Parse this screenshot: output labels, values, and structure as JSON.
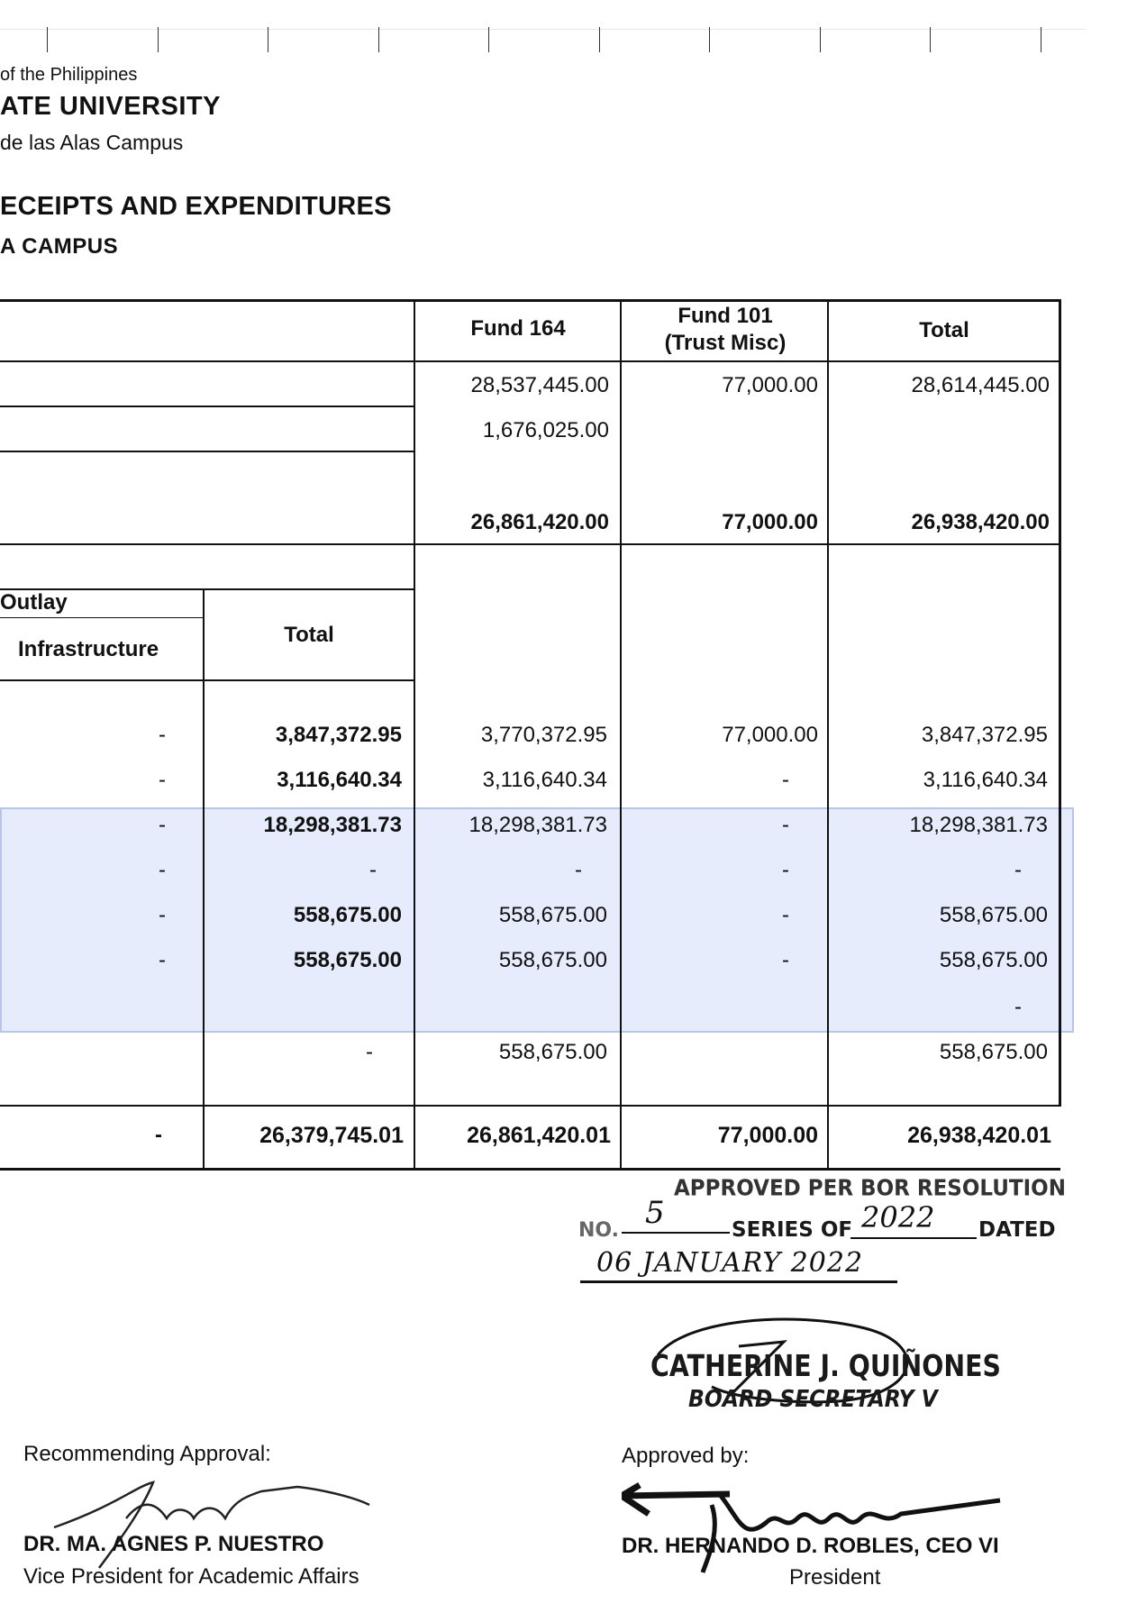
{
  "header": {
    "country": "of the Philippines",
    "university": "ATE UNIVERSITY",
    "campus": "de las Alas Campus",
    "title": "ECEIPTS AND EXPENDITURES",
    "subtitle": "A CAMPUS"
  },
  "table": {
    "col_fund164": "Fund 164",
    "col_fund101_l1": "Fund 101",
    "col_fund101_l2": "(Trust Misc)",
    "col_total": "Total",
    "sub_outlay": "Outlay",
    "sub_infrastructure": "Infrastructure",
    "sub_total": "Total",
    "receipts": [
      {
        "fund164": "28,537,445.00",
        "fund101": "77,000.00",
        "total": "28,614,445.00"
      },
      {
        "fund164": "1,676,025.00",
        "fund101": "",
        "total": ""
      },
      {
        "fund164": "26,861,420.00",
        "fund101": "77,000.00",
        "total": "26,938,420.00"
      }
    ],
    "expenditures": [
      {
        "infra": "-",
        "subtotal": "3,847,372.95",
        "fund164": "3,770,372.95",
        "fund101": "77,000.00",
        "total": "3,847,372.95"
      },
      {
        "infra": "-",
        "subtotal": "3,116,640.34",
        "fund164": "3,116,640.34",
        "fund101": "-",
        "total": "3,116,640.34"
      },
      {
        "infra": "-",
        "subtotal": "18,298,381.73",
        "fund164": "18,298,381.73",
        "fund101": "-",
        "total": "18,298,381.73"
      },
      {
        "infra": "-",
        "subtotal": "-",
        "fund164": "-",
        "fund101": "-",
        "total": "-"
      },
      {
        "infra": "-",
        "subtotal": "558,675.00",
        "fund164": "558,675.00",
        "fund101": "-",
        "total": "558,675.00"
      },
      {
        "infra": "-",
        "subtotal": "558,675.00",
        "fund164": "558,675.00",
        "fund101": "-",
        "total": "558,675.00"
      },
      {
        "infra": "",
        "subtotal": "",
        "fund164": "",
        "fund101": "",
        "total": "-"
      },
      {
        "infra": "",
        "subtotal": "-",
        "fund164": "558,675.00",
        "fund101": "",
        "total": "558,675.00"
      }
    ],
    "grand_total": {
      "infra": "-",
      "subtotal": "26,379,745.01",
      "fund164": "26,861,420.01",
      "fund101": "77,000.00",
      "total": "26,938,420.01"
    }
  },
  "stamp": {
    "line1": "APPROVED PER BOR RESOLUTION",
    "no_prefix": "NO.",
    "no_value": "5",
    "series_label": "SERIES OF",
    "series_value": "2022",
    "dated_label": "DATED",
    "date_value": "06 JANUARY 2022",
    "secretary_name": "CATHERINE J. QUIÑONES",
    "secretary_title": "BOARD SECRETARY V"
  },
  "signatories": {
    "recommending_label": "Recommending Approval:",
    "recommending_name": "DR. MA. AGNES P. NUESTRO",
    "recommending_title": "Vice President  for Academic Affairs",
    "approved_label": "Approved by:",
    "approved_name": "DR. HERNANDO D. ROBLES, CEO VI",
    "approved_title": "President"
  }
}
